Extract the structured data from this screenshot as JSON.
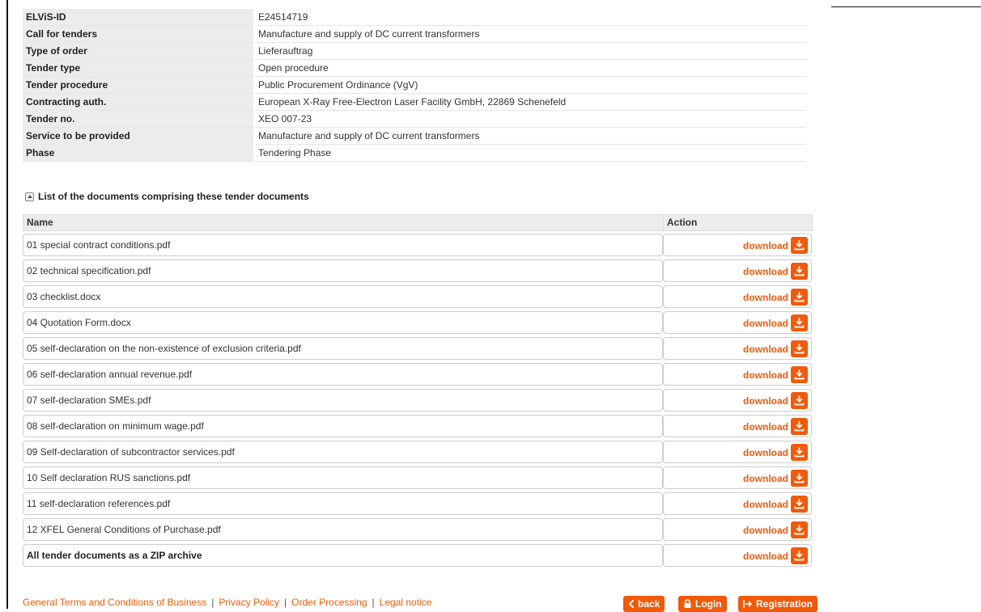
{
  "tender_info": [
    {
      "label": "ELViS-ID",
      "value": "E24514719"
    },
    {
      "label": "Call for tenders",
      "value": "Manufacture and supply of DC current transformers"
    },
    {
      "label": "Type of order",
      "value": "Lieferauftrag"
    },
    {
      "label": "Tender type",
      "value": "Open procedure"
    },
    {
      "label": "Tender procedure",
      "value": "Public Procurement Ordinance (VgV)"
    },
    {
      "label": "Contracting auth.",
      "value": "European X-Ray Free-Electron Laser Facility GmbH, 22869 Schenefeld"
    },
    {
      "label": "Tender no.",
      "value": "XEO 007-23"
    },
    {
      "label": "Service to be provided",
      "value": "Manufacture and supply of DC current transformers"
    },
    {
      "label": "Phase",
      "value": "Tendering Phase"
    }
  ],
  "documents_section": {
    "title": "List of the documents comprising these tender documents",
    "col_name": "Name",
    "col_action": "Action",
    "download_label": "download",
    "rows": [
      "01 special contract conditions.pdf",
      "02 technical specification.pdf",
      "03 checklist.docx",
      "04 Quotation Form.docx",
      "05 self-declaration on the non-existence of exclusion criteria.pdf",
      "06 self-declaration annual revenue.pdf",
      "07 self-declaration SMEs.pdf",
      "08 self-declaration on minimum wage.pdf",
      "09 Self-declaration of subcontractor services.pdf",
      "10 Self declaration RUS sanctions.pdf",
      "11 self-declaration references.pdf",
      "12 XFEL General Conditions of Purchase.pdf"
    ],
    "zip_label": "All tender documents as a ZIP archive"
  },
  "footer": {
    "links": [
      "General Terms and Conditions of Business",
      "Privacy Policy",
      "Order Processing",
      "Legal notice"
    ]
  },
  "buttons": {
    "back": "back",
    "login": "Login",
    "registration": "Registration"
  },
  "colors": {
    "accent": "#f05a0a",
    "label_bg": "#ececec"
  }
}
